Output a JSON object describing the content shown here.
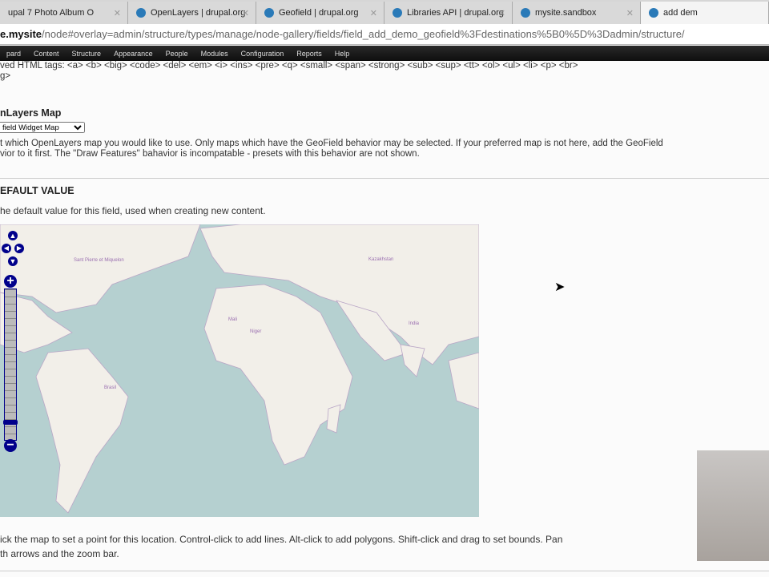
{
  "browser": {
    "tabs": [
      {
        "label": "upal 7 Photo Album O"
      },
      {
        "label": "OpenLayers | drupal.org"
      },
      {
        "label": "Geofield | drupal.org"
      },
      {
        "label": "Libraries API | drupal.org"
      },
      {
        "label": "mysite.sandbox"
      },
      {
        "label": "add dem"
      }
    ],
    "url_host": "e.mysite",
    "url_path": "/node#overlay=admin/structure/types/manage/node-gallery/fields/field_add_demo_geofield%3Fdestinations%5B0%5D%3Dadmin/structure/"
  },
  "admin_menu": [
    "pard",
    "Content",
    "Structure",
    "Appearance",
    "People",
    "Modules",
    "Configuration",
    "Reports",
    "Help"
  ],
  "page": {
    "allowed_tags": "ved HTML tags: <a> <b> <big> <code> <del> <em> <i> <ins> <pre> <q> <small> <span> <strong> <sub> <sup> <tt> <ol> <ul> <li> <p> <br>",
    "allowed_tags_2": "g>",
    "map_heading": "nLayers Map",
    "map_select": "field Widget Map",
    "map_desc_1": "t which OpenLayers map you would like to use. Only maps which have the GeoField behavior may be selected. If your preferred map is not here, add the GeoField",
    "map_desc_2": "vior to it first. The \"Draw Features\" bahavior is incompatable - presets with this behavior are not shown.",
    "default_heading": "EFAULT VALUE",
    "default_desc": "he default value for this field, used when creating new content.",
    "help_1": "ick the map to set a point for this location. Control-click to add lines. Alt-click to add polygons. Shift-click and drag to set bounds. Pan",
    "help_2": "th arrows and the zoom bar."
  },
  "map": {
    "labels": {
      "na": "Sant Pierre et Miquelon",
      "brasil": "Brasil",
      "niger": "Niger",
      "india": "India",
      "mali": "Mali",
      "kazakh": "Kazakhstan"
    },
    "ocean_color": "#b5d0d0",
    "land_color": "#f2efe9"
  }
}
